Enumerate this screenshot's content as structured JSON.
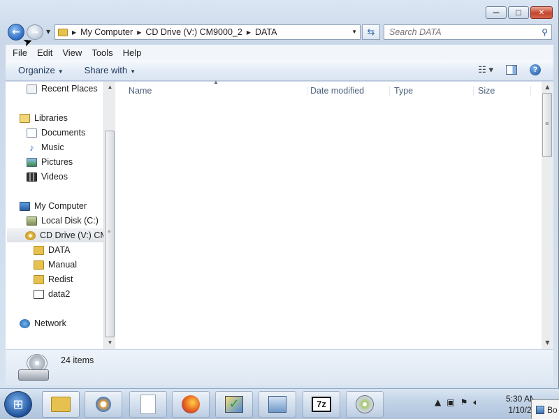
{
  "window": {
    "buttons": {
      "minimize": "—",
      "maximize": "□",
      "close": "✕"
    }
  },
  "address": {
    "crumbs": [
      "My Computer",
      "CD Drive (V:) CM9000_2",
      "DATA"
    ]
  },
  "search": {
    "placeholder": "Search DATA"
  },
  "menubar": {
    "items": [
      "File",
      "Edit",
      "View",
      "Tools",
      "Help"
    ]
  },
  "commandbar": {
    "organize": "Organize",
    "share": "Share with"
  },
  "navpane": {
    "items": [
      {
        "label": "Recent Places",
        "icon": "recent-places-icon"
      },
      {
        "label": "Libraries",
        "icon": "libraries-icon"
      },
      {
        "label": "Documents",
        "icon": "documents-icon"
      },
      {
        "label": "Music",
        "icon": "music-icon"
      },
      {
        "label": "Pictures",
        "icon": "pictures-icon"
      },
      {
        "label": "Videos",
        "icon": "videos-icon"
      },
      {
        "label": "My Computer",
        "icon": "computer-icon"
      },
      {
        "label": "Local Disk (C:)",
        "icon": "local-disk-icon"
      },
      {
        "label": "CD Drive (V:) CM",
        "icon": "cd-drive-icon",
        "selected": true
      },
      {
        "label": "DATA",
        "icon": "folder-icon"
      },
      {
        "label": "Manual",
        "icon": "folder-icon"
      },
      {
        "label": "Redist",
        "icon": "folder-icon"
      },
      {
        "label": "data2",
        "icon": "file-icon"
      },
      {
        "label": "Network",
        "icon": "network-icon"
      }
    ]
  },
  "filelist": {
    "columns": [
      "Name",
      "Date modified",
      "Type",
      "Size"
    ]
  },
  "details": {
    "count": "24 items"
  },
  "taskbar": {
    "apps": [
      {
        "name": "explorer",
        "icon": "folder-icon",
        "active": true
      },
      {
        "name": "media-player",
        "icon": "media-player-icon"
      },
      {
        "name": "blank-document",
        "icon": "document-icon"
      },
      {
        "name": "firefox",
        "icon": "firefox-icon"
      },
      {
        "name": "installer",
        "icon": "installer-check-icon"
      },
      {
        "name": "control-panel",
        "icon": "control-panel-icon"
      },
      {
        "name": "7zip",
        "icon": "7zip-icon",
        "label": "7z"
      },
      {
        "name": "cd-app",
        "icon": "cd-app-icon"
      }
    ],
    "clock_time": "5:30 AM",
    "clock_date": "1/10/2",
    "popup_text": "Bo"
  }
}
